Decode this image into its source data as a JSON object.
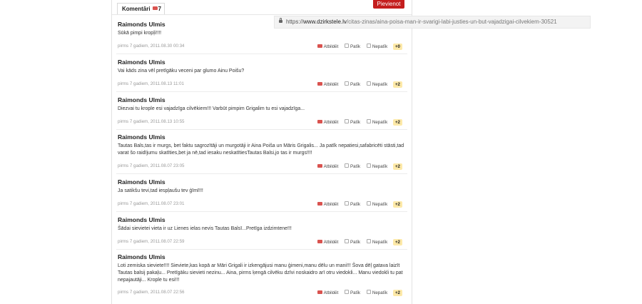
{
  "tabs": {
    "comments_label": "Komentāri",
    "comments_count": "7"
  },
  "post_button": "Pievienot",
  "urlbar": {
    "domain_prefix": "https://",
    "domain": "www.dzirkstele.lv",
    "path": "/citas-zinas/aina-poisa-man-ir-svarigi-labi-justies-un-but-vajadzigai-cilvekiem-30521"
  },
  "actions": {
    "reply": "Atbildēt",
    "like": "Patīk",
    "dislike": "Nepatīk"
  },
  "comments": [
    {
      "author": "Raimonds Ulmis",
      "text": "Sūkā pimpi kropļi!!!!",
      "time": "pirms 7 gadiem, 2011.08.30 00:34",
      "score": "+0"
    },
    {
      "author": "Raimonds Ulmis",
      "text": "Vai kāds zina vēl pretīgāku veceni par glumo Ainu Poišu?",
      "time": "pirms 7 gadiem, 2011.08.13 11:01",
      "score": "+2"
    },
    {
      "author": "Raimonds Ulmis",
      "text": "Diezvai tu kroplе esi vajadzīga cilvēkiem!!! Varbūt pimpim Grigalim tu esi vajadzīga...",
      "time": "pirms 7 gadiem, 2011.08.13 10:55",
      "score": "+2"
    },
    {
      "author": "Raimonds Ulmis",
      "text": "Tautas Bals,tas ir murgs, bet faktu sagrozītāji un murgotāji ir Aina Poiša un Māris Grigalis... Ja patīk nepatiesi,safabricēti stāsti,tad varat šo raidījumu skatīties,bet ja nē,tad iesaku neskatītiesTautas Balsi,jo tas ir murgs!!!!",
      "time": "pirms 7 gadiem, 2011.08.07 23:05",
      "score": "+2"
    },
    {
      "author": "Raimonds Ulmis",
      "text": "Ja satikšu tevi,tad iespļaušu tev ģīmī!!!",
      "time": "pirms 7 gadiem, 2011.08.07 23:01",
      "score": "+2"
    },
    {
      "author": "Raimonds Ulmis",
      "text": "Šādai sievietei vieta ir uz Lienes ielas nevis Tautas Balsī...Pretīga izdzimtene!!!",
      "time": "pirms 7 gadiem, 2011.08.07 22:59",
      "score": "+2"
    },
    {
      "author": "Raimonds Ulmis",
      "text": "Loti zemiska sieviete!!!! Sieviete,kas kopā ar Māri Grigali ir izkengājusi manu ģimeni,manu dēlu un mani!!! Šova dēļ gatava laizīt Tautas balsij pakaļu... Pretīgāku sievieti nezinu... Aina, pirms ķengā cilvēku dzīvi noskaidro arī otru viedokli... Manu viedokli tu pat nepajautāji... Kroplе tu esi!!!",
      "time": "pirms 7 gadiem, 2011.08.07 22:56",
      "score": "+2"
    }
  ]
}
